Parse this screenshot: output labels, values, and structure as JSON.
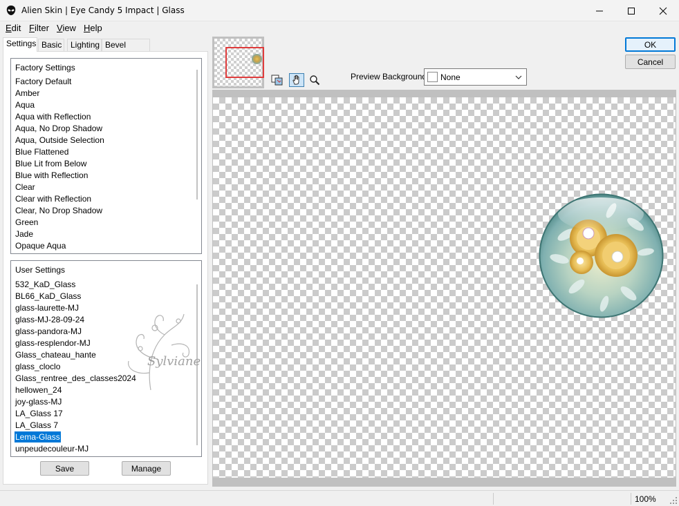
{
  "window": {
    "title": "Alien Skin | Eye Candy 5 Impact | Glass"
  },
  "menu": [
    {
      "key": "E",
      "rest": "dit"
    },
    {
      "key": "F",
      "rest": "ilter"
    },
    {
      "key": "V",
      "rest": "iew"
    },
    {
      "key": "H",
      "rest": "elp"
    }
  ],
  "tabs": [
    "Settings",
    "Basic",
    "Lighting",
    "Bevel Profile"
  ],
  "factory": {
    "header": "Factory Settings",
    "items": [
      "Factory Default",
      "Amber",
      "Aqua",
      "Aqua with Reflection",
      "Aqua, No Drop Shadow",
      "Aqua, Outside Selection",
      "Blue Flattened",
      "Blue Lit from Below",
      "Blue with Reflection",
      "Clear",
      "Clear with Reflection",
      "Clear, No Drop Shadow",
      "Green",
      "Jade",
      "Opaque Aqua"
    ]
  },
  "user": {
    "header": "User Settings",
    "items": [
      "532_KaD_Glass",
      "BL66_KaD_Glass",
      "glass-laurette-MJ",
      "glass-MJ-28-09-24",
      "glass-pandora-MJ",
      "glass-resplendor-MJ",
      "Glass_chateau_hante",
      "glass_cloclo",
      "Glass_rentree_des_classes2024",
      "hellowen_24",
      "joy-glass-MJ",
      "LA_Glass 17",
      "LA_Glass 7",
      "Lema-Glass",
      "unpeudecouleur-MJ"
    ],
    "selected_index": 13
  },
  "buttons": {
    "save": "Save",
    "manage": "Manage",
    "ok": "OK",
    "cancel": "Cancel"
  },
  "preview_background": {
    "label": "Preview Background:",
    "value": "None"
  },
  "watermark_text": "Sylviane",
  "status": {
    "zoom": "100%"
  },
  "colors": {
    "selection": "#0078d7",
    "nav_rect": "#e03c3c"
  }
}
